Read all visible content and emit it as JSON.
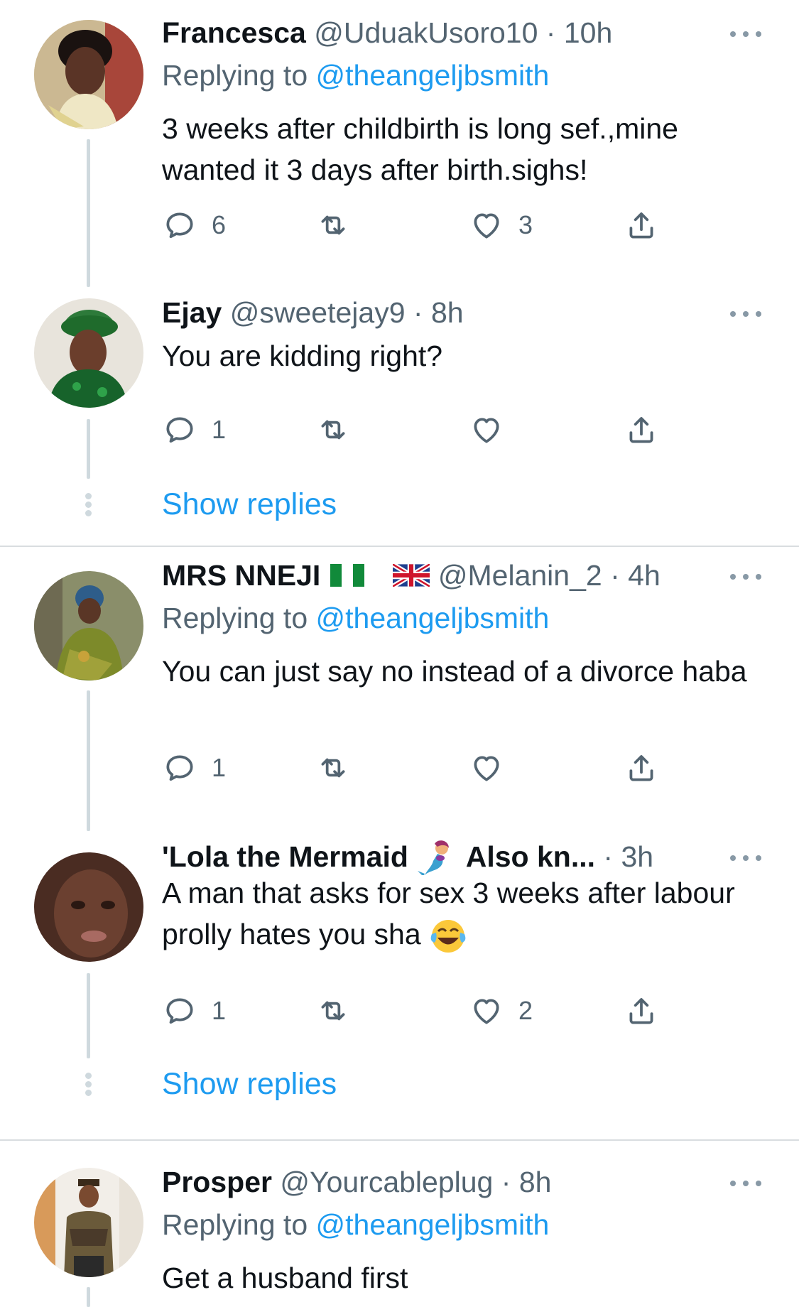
{
  "accent_color": "#1d9bf0",
  "muted_color": "#536471",
  "tweets": [
    {
      "name": "Francesca",
      "handle": "@UduakUsoro10",
      "dot": "·",
      "time": "10h",
      "replying_prefix": "Replying to",
      "replying_to": "@theangeljbsmith",
      "text": "3 weeks after childbirth is long sef.,mine wanted it 3 days after birth.sighs!",
      "reply_count": "6",
      "retweet_count": "",
      "like_count": "3"
    },
    {
      "name": "Ejay",
      "handle": "@sweetejay9",
      "dot": "·",
      "time": "8h",
      "text": "You are kidding right?",
      "reply_count": "1",
      "retweet_count": "",
      "like_count": ""
    },
    {
      "name": "MRS NNEJI",
      "name_flags": [
        "nigeria-flag",
        "uk-flag"
      ],
      "handle": "@Melanin_2",
      "dot": "·",
      "time": "4h",
      "replying_prefix": "Replying to",
      "replying_to": "@theangeljbsmith",
      "text": "You can just say no instead of a divorce haba",
      "reply_count": "1",
      "retweet_count": "",
      "like_count": ""
    },
    {
      "name": "'Lola the Mermaid",
      "name_suffix": "Also kn...",
      "name_emoji": "mermaid-emoji",
      "dot": "·",
      "time": "3h",
      "text": "A man that asks for sex 3 weeks after labour prolly hates you sha",
      "text_emoji": "tears-of-joy-emoji",
      "reply_count": "1",
      "retweet_count": "",
      "like_count": "2"
    },
    {
      "name": "Prosper",
      "handle": "@Yourcableplug",
      "dot": "·",
      "time": "8h",
      "replying_prefix": "Replying to",
      "replying_to": "@theangeljbsmith",
      "text": "Get a husband first"
    }
  ],
  "show_replies_label": "Show replies",
  "icons": [
    "reply-icon",
    "retweet-icon",
    "like-icon",
    "share-icon",
    "more-icon"
  ]
}
